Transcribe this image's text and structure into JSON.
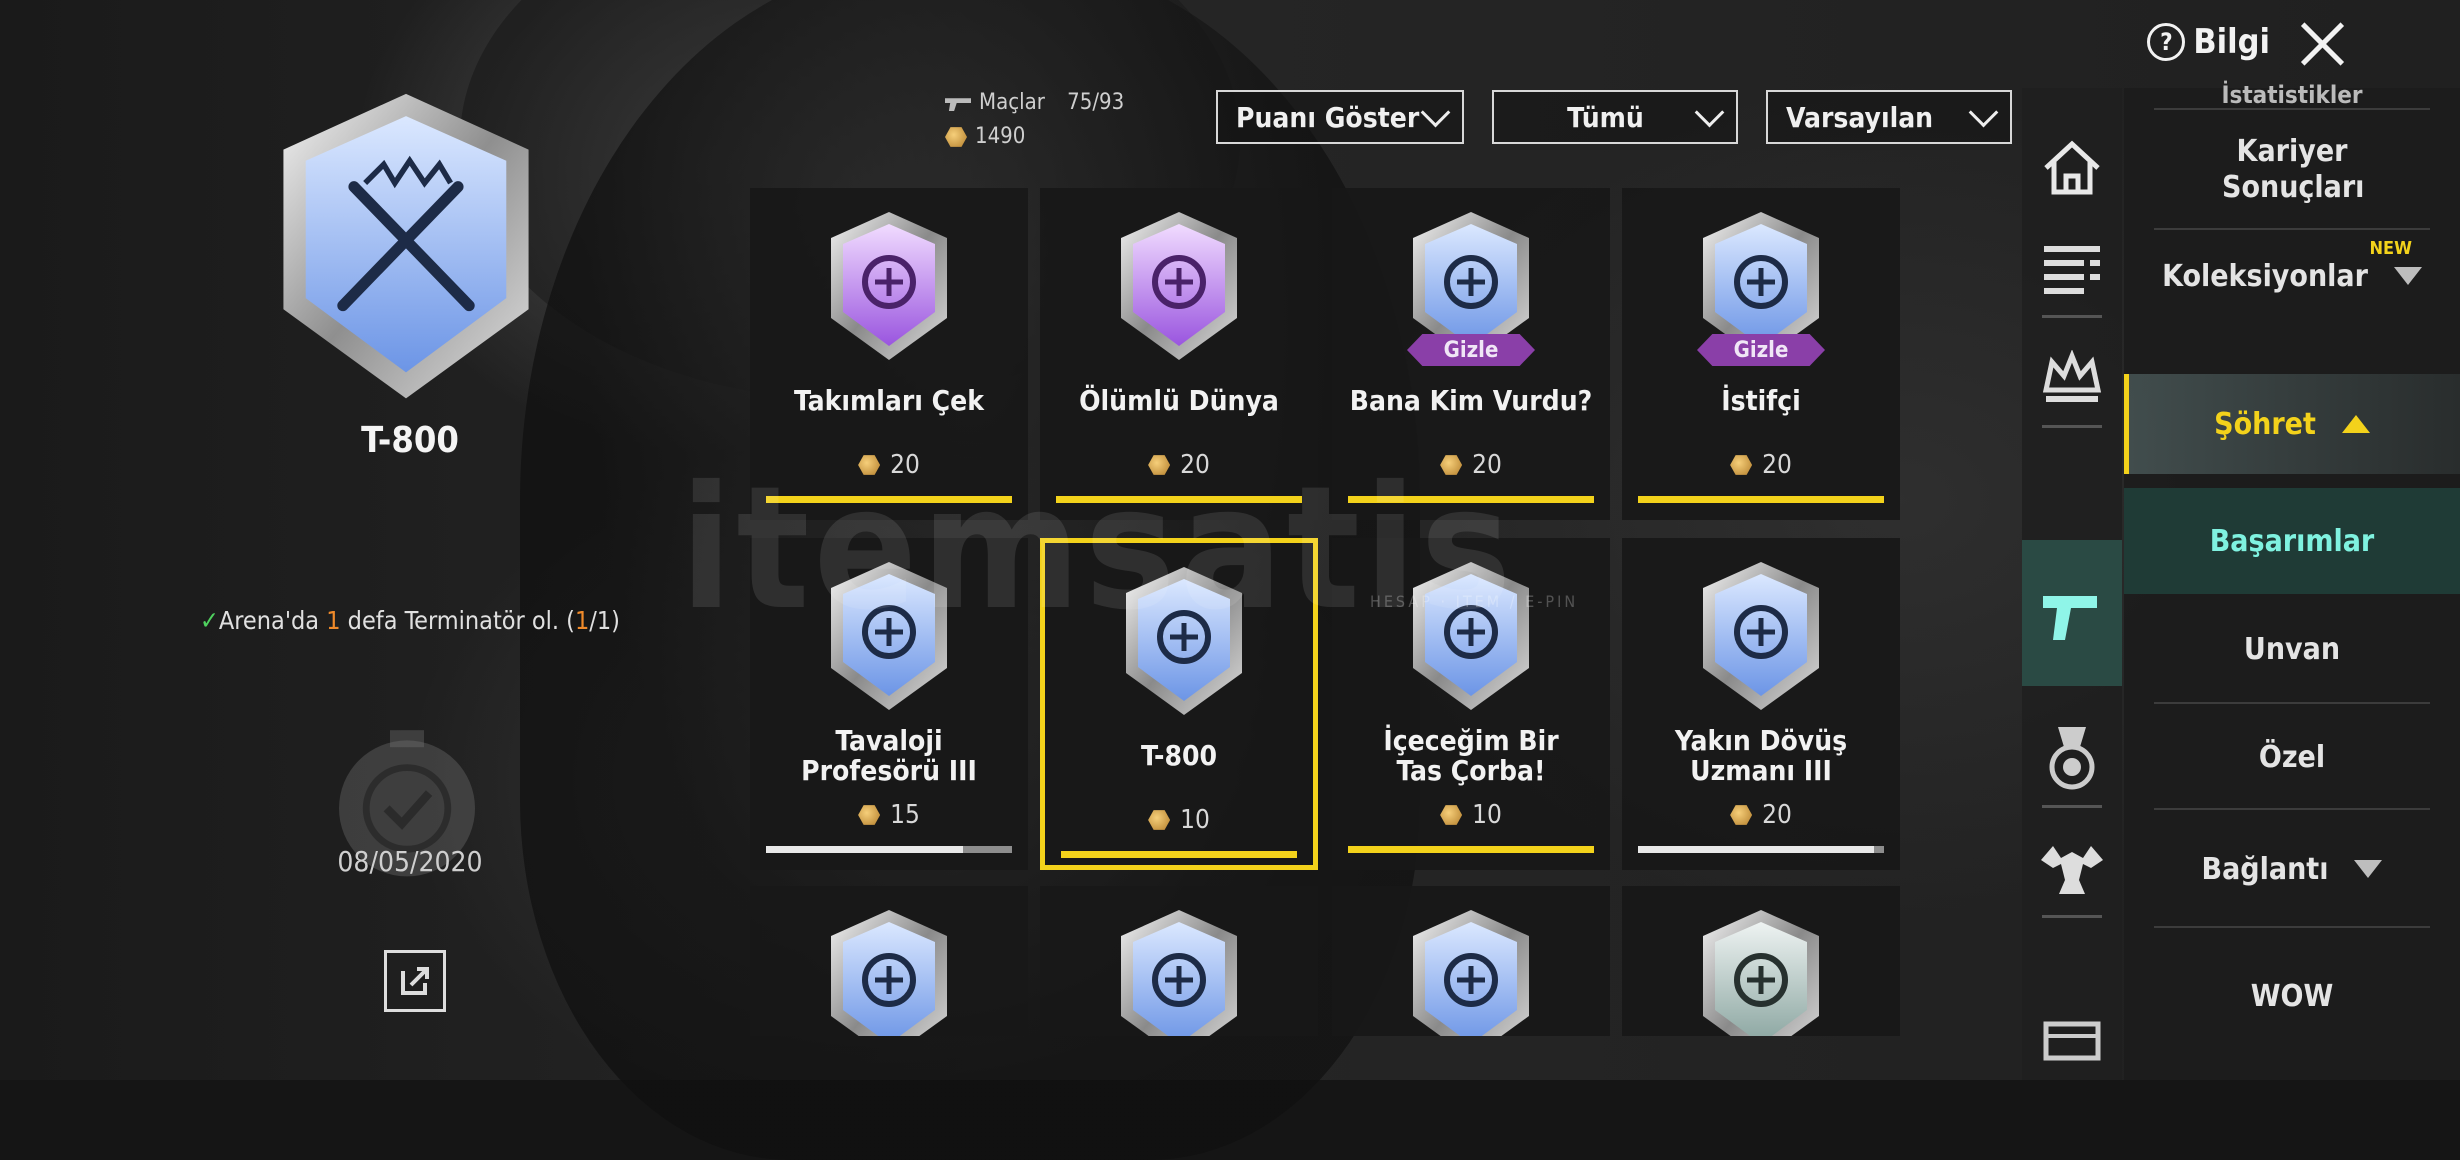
{
  "header": {
    "info_label": "Bilgi",
    "info_icon": "question-circle-icon",
    "close_icon": "close-icon",
    "matches_label": "Maçlar",
    "matches_value": "75/93",
    "points_total": "1490"
  },
  "filters": {
    "show_points": "Puanı Göster",
    "category": "Tümü",
    "sort": "Varsayılan"
  },
  "selected": {
    "title": "T-800",
    "description_prefix": "Arena'da ",
    "description_count": "1",
    "description_mid": " defa Terminatör ol. (",
    "progress_done": "1",
    "progress_total": "/1)",
    "date": "08/05/2020",
    "check_icon": "checkmark-icon",
    "share_icon": "external-link-icon"
  },
  "achievements": [
    {
      "name": "Takımları Çek",
      "points": "20",
      "tier": "purple",
      "hidden": false,
      "progress": 1.0,
      "bar": "yellow"
    },
    {
      "name": "Ölümlü Dünya",
      "points": "20",
      "tier": "purple",
      "hidden": false,
      "progress": 1.0,
      "bar": "yellow"
    },
    {
      "name": "Bana Kim Vurdu?",
      "points": "20",
      "tier": "blue",
      "hidden": true,
      "hide_label": "Gizle",
      "progress": 1.0,
      "bar": "yellow"
    },
    {
      "name": "İstifçi",
      "points": "20",
      "tier": "blue",
      "hidden": true,
      "hide_label": "Gizle",
      "progress": 1.0,
      "bar": "yellow"
    },
    {
      "name": "Tavaloji Profesörü III",
      "points": "15",
      "tier": "blue",
      "hidden": false,
      "progress": 0.8,
      "bar": "gray"
    },
    {
      "name": "T-800",
      "points": "10",
      "tier": "blue",
      "hidden": false,
      "progress": 1.0,
      "bar": "yellow",
      "selected": true
    },
    {
      "name": "İçeceğim Bir Tas Çorba!",
      "points": "10",
      "tier": "blue",
      "hidden": false,
      "progress": 1.0,
      "bar": "yellow"
    },
    {
      "name": "Yakın Dövüş Uzmanı III",
      "points": "20",
      "tier": "blue",
      "hidden": false,
      "progress": 0.96,
      "bar": "gray"
    },
    {
      "name": "",
      "points": "",
      "tier": "blue"
    },
    {
      "name": "",
      "points": "",
      "tier": "blue"
    },
    {
      "name": "",
      "points": "",
      "tier": "blue"
    },
    {
      "name": "",
      "points": "",
      "tier": "silver"
    }
  ],
  "nav_icons": [
    "home-icon",
    "list-icon",
    "crown-icon",
    "pistol-icon",
    "medal-icon",
    "muscle-icon",
    "crate-icon"
  ],
  "sidebar": {
    "top_partial": "İstatistikler",
    "career": "Kariyer Sonuçları",
    "collections": "Koleksiyonlar",
    "new_tag": "NEW",
    "fame": "Şöhret",
    "achievements": "Başarımlar",
    "title": "Unvan",
    "special": "Özel",
    "connection": "Bağlantı",
    "wow": "WOW"
  },
  "watermark": {
    "text": "itemsatis",
    "sub": "HESAP · ITEM / E-PIN"
  },
  "colors": {
    "accent_yellow": "#f3d21b",
    "active_teal": "#7ff2e0",
    "hide_purple": "#8a3fa8"
  }
}
